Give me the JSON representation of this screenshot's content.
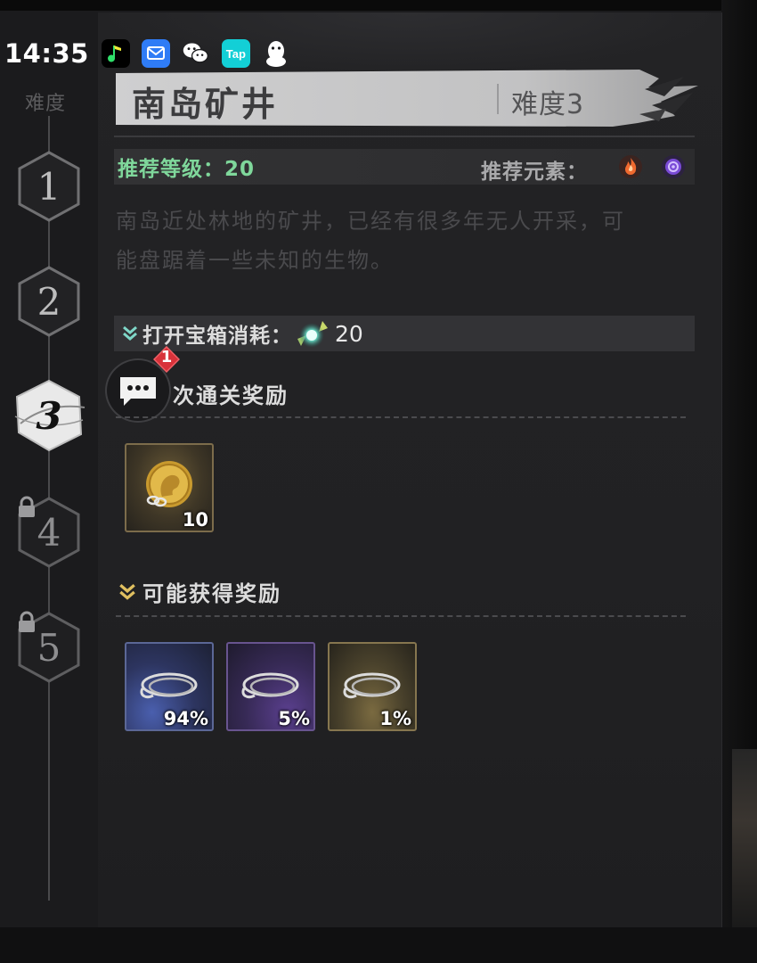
{
  "status_bar": {
    "time": "14:35",
    "apps": [
      "music-app-icon",
      "mail-app-icon",
      "wechat-icon",
      "taptap-icon",
      "qq-icon"
    ],
    "tap_label": "Tap"
  },
  "rail": {
    "title": "难度",
    "levels": [
      {
        "label": "1",
        "state": "unlocked"
      },
      {
        "label": "2",
        "state": "unlocked"
      },
      {
        "label": "3",
        "state": "selected"
      },
      {
        "label": "4",
        "state": "locked"
      },
      {
        "label": "5",
        "state": "locked"
      }
    ]
  },
  "stage": {
    "title": "南岛矿井",
    "difficulty": "难度3",
    "recommended_level": "推荐等级：20",
    "recommended_elements_label": "推荐元素：",
    "elements": [
      "fire-element-icon",
      "arcane-element-icon"
    ],
    "description_line1": "南岛近处林地的矿井，已经有很多年无人开采，可",
    "description_line2": "能盘踞着一些未知的生物。"
  },
  "chest": {
    "cost_label": "打开宝箱消耗：",
    "cost_value": "20"
  },
  "first_clear": {
    "title": "次通关奖励",
    "notification_count": "1",
    "rewards": [
      {
        "icon": "gold-coin-icon",
        "quantity": "10",
        "rarity": "gold"
      }
    ]
  },
  "possible": {
    "title": "可能获得奖励",
    "rewards": [
      {
        "icon": "rope-icon",
        "chance": "94%",
        "rarity": "blue"
      },
      {
        "icon": "rope-icon",
        "chance": "5%",
        "rarity": "purple"
      },
      {
        "icon": "rope-icon",
        "chance": "1%",
        "rarity": "gold"
      }
    ]
  },
  "colors": {
    "accent_green": "#7fd79b",
    "panel_bg": "#232325",
    "fire": "#e2572c",
    "arcane": "#7a4bd6"
  }
}
